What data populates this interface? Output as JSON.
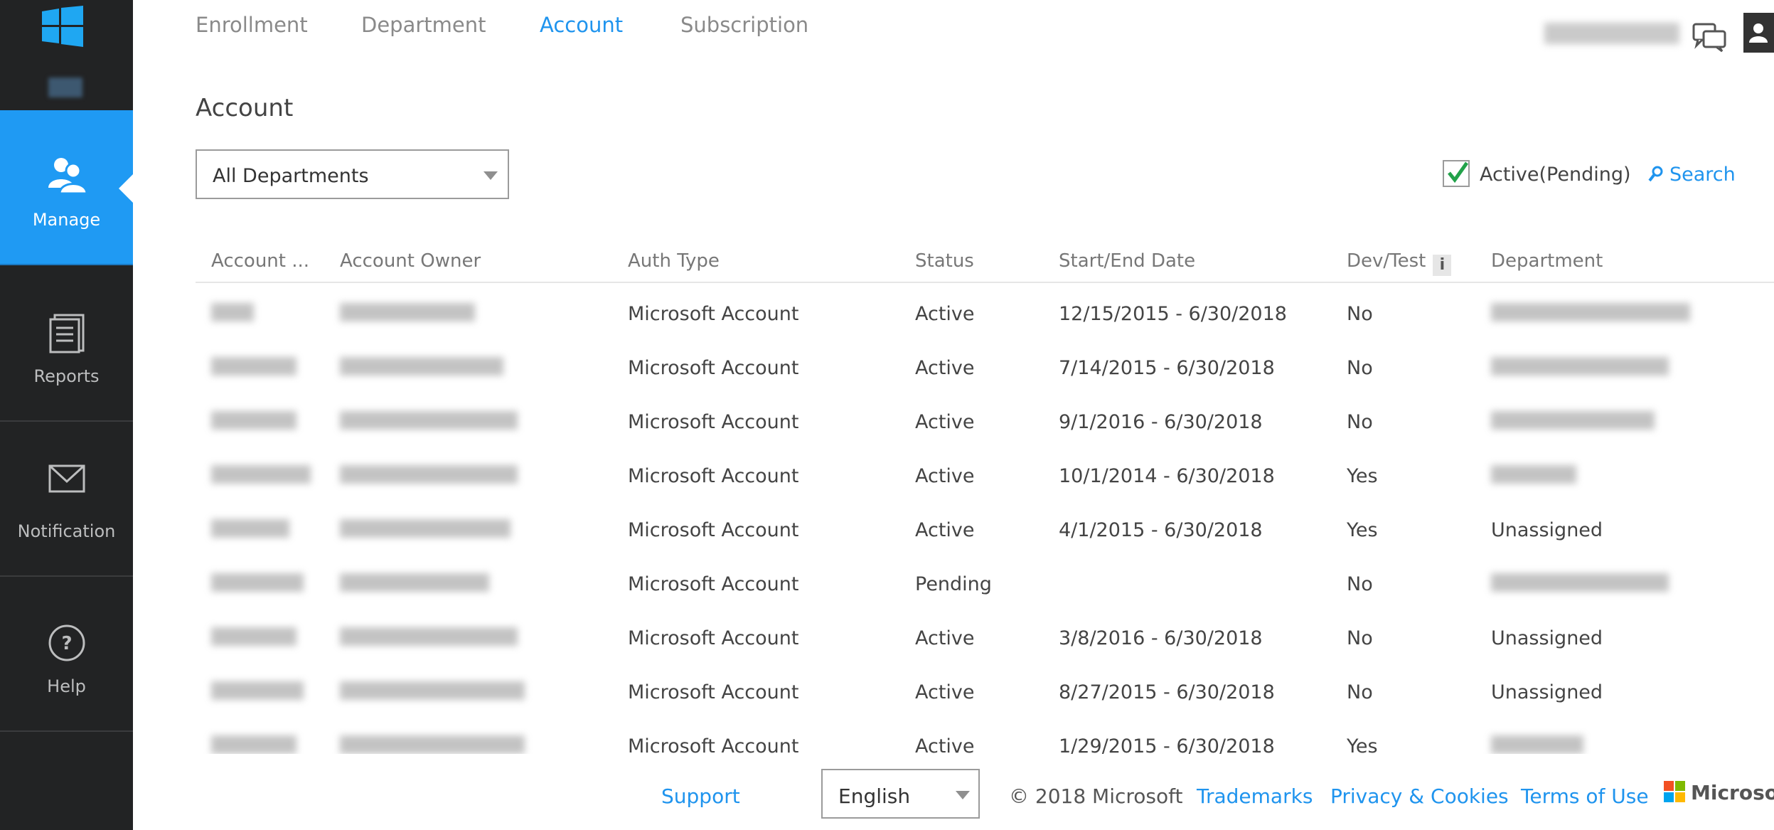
{
  "rail": {
    "items": [
      {
        "label": "Manage",
        "icon": "users-icon"
      },
      {
        "label": "Reports",
        "icon": "document-icon"
      },
      {
        "label": "Notification",
        "icon": "mail-icon"
      },
      {
        "label": "Help",
        "icon": "question-icon"
      }
    ]
  },
  "nav": {
    "tabs": [
      "Enrollment",
      "Department",
      "Account",
      "Subscription"
    ],
    "active": "Account"
  },
  "page": {
    "title": "Account",
    "department_filter": "All Departments",
    "active_pending_label": "Active(Pending)",
    "active_pending_checked": true,
    "search_label": "Search"
  },
  "table": {
    "headers": [
      "Account ...",
      "Account Owner",
      "Auth Type",
      "Status",
      "Start/End Date",
      "Dev/Test",
      "Department"
    ],
    "rows": [
      {
        "auth": "Microsoft Account",
        "status": "Active",
        "dates": "12/15/2015 - 6/30/2018",
        "devtest": "No",
        "department": ""
      },
      {
        "auth": "Microsoft Account",
        "status": "Active",
        "dates": "7/14/2015 - 6/30/2018",
        "devtest": "No",
        "department": ""
      },
      {
        "auth": "Microsoft Account",
        "status": "Active",
        "dates": "9/1/2016 - 6/30/2018",
        "devtest": "No",
        "department": ""
      },
      {
        "auth": "Microsoft Account",
        "status": "Active",
        "dates": "10/1/2014 - 6/30/2018",
        "devtest": "Yes",
        "department": ""
      },
      {
        "auth": "Microsoft Account",
        "status": "Active",
        "dates": "4/1/2015 - 6/30/2018",
        "devtest": "Yes",
        "department": "Unassigned"
      },
      {
        "auth": "Microsoft Account",
        "status": "Pending",
        "dates": "",
        "devtest": "No",
        "department": ""
      },
      {
        "auth": "Microsoft Account",
        "status": "Active",
        "dates": "3/8/2016 - 6/30/2018",
        "devtest": "No",
        "department": "Unassigned"
      },
      {
        "auth": "Microsoft Account",
        "status": "Active",
        "dates": "8/27/2015 - 6/30/2018",
        "devtest": "No",
        "department": "Unassigned"
      },
      {
        "auth": "Microsoft Account",
        "status": "Active",
        "dates": "1/29/2015 - 6/30/2018",
        "devtest": "Yes",
        "department": ""
      }
    ]
  },
  "footer": {
    "support": "Support",
    "language": "English",
    "copyright": "© 2018 Microsoft",
    "trademarks": "Trademarks",
    "privacy": "Privacy & Cookies",
    "terms": "Terms of Use",
    "brand": "Microsoft"
  },
  "colors": {
    "rail_bg": "#222324",
    "accent": "#1f9af3",
    "link": "#1f94ee",
    "check": "#22a24a"
  }
}
